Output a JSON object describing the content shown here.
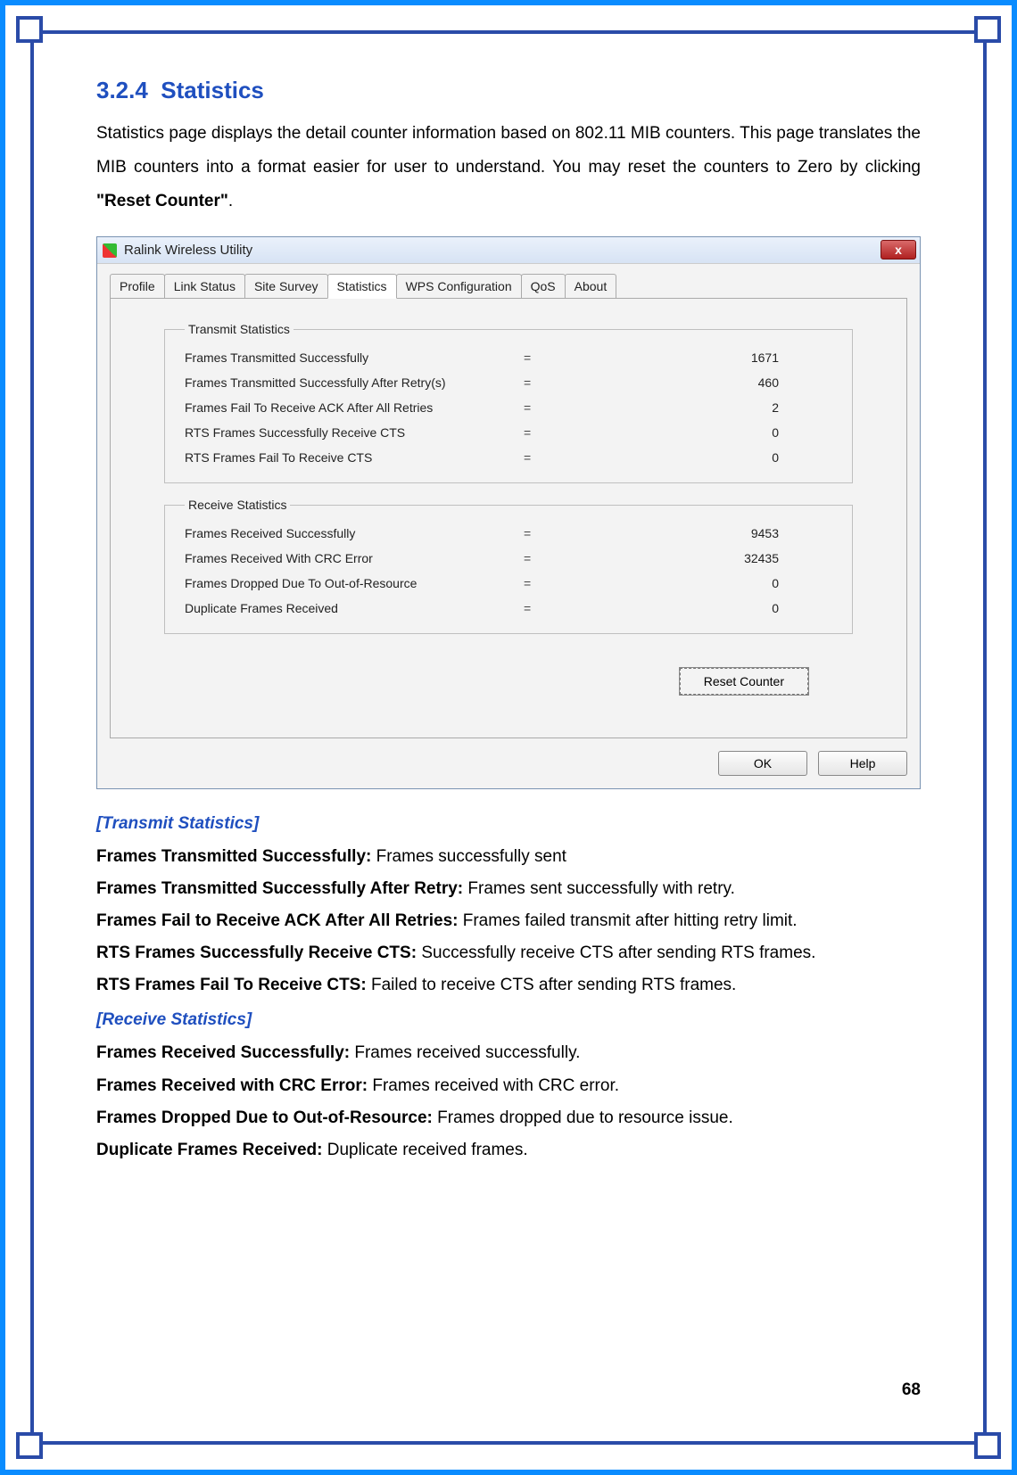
{
  "section": {
    "number": "3.2.4",
    "title": "Statistics",
    "intro_pre": "Statistics page displays the detail counter information based on 802.11 MIB counters. This page translates the MIB counters into a format easier for user to understand. You may reset the counters to Zero by clicking ",
    "intro_bold": "\"Reset Counter\"",
    "intro_post": "."
  },
  "dialog": {
    "title": "Ralink Wireless Utility",
    "close_x": "x",
    "tabs": [
      "Profile",
      "Link Status",
      "Site Survey",
      "Statistics",
      "WPS Configuration",
      "QoS",
      "About"
    ],
    "active_tab_index": 3,
    "transmit_legend": "Transmit Statistics",
    "receive_legend": "Receive Statistics",
    "transmit_rows": [
      {
        "label": "Frames Transmitted Successfully",
        "value": "1671"
      },
      {
        "label": "Frames Transmitted Successfully After Retry(s)",
        "value": "460"
      },
      {
        "label": "Frames Fail To Receive ACK After All Retries",
        "value": "2"
      },
      {
        "label": "RTS Frames Successfully Receive CTS",
        "value": "0"
      },
      {
        "label": "RTS Frames Fail To Receive CTS",
        "value": "0"
      }
    ],
    "receive_rows": [
      {
        "label": "Frames Received Successfully",
        "value": "9453"
      },
      {
        "label": "Frames Received With CRC Error",
        "value": "32435"
      },
      {
        "label": "Frames Dropped Due To Out-of-Resource",
        "value": "0"
      },
      {
        "label": "Duplicate Frames Received",
        "value": "0"
      }
    ],
    "reset_btn": "Reset Counter",
    "ok_btn": "OK",
    "help_btn": "Help"
  },
  "desc": {
    "transmit_heading": "[Transmit Statistics]",
    "receive_heading": "[Receive Statistics]",
    "transmit_items": [
      {
        "term": "Frames Transmitted Successfully: ",
        "def": "Frames successfully sent"
      },
      {
        "term": "Frames Transmitted Successfully After Retry: ",
        "def": "Frames sent successfully with retry."
      },
      {
        "term": "Frames Fail to Receive ACK After All Retries: ",
        "def": "Frames failed transmit after hitting retry limit."
      },
      {
        "term": "RTS Frames Successfully Receive CTS: ",
        "def": "Successfully receive CTS after sending RTS frames."
      },
      {
        "term": "RTS Frames Fail To Receive CTS: ",
        "def": "Failed to receive CTS after sending RTS frames."
      }
    ],
    "receive_items": [
      {
        "term": "Frames Received Successfully: ",
        "def": "Frames received successfully."
      },
      {
        "term": "Frames Received with CRC Error: ",
        "def": "Frames received with CRC error."
      },
      {
        "term": "Frames Dropped Due to Out-of-Resource: ",
        "def": "Frames dropped due to resource issue."
      },
      {
        "term": "Duplicate Frames Received: ",
        "def": "Duplicate received frames."
      }
    ]
  },
  "page_number": "68",
  "chart_data": {
    "type": "table",
    "title": "Statistics",
    "series": [
      {
        "name": "Transmit Statistics",
        "categories": [
          "Frames Transmitted Successfully",
          "Frames Transmitted Successfully After Retry(s)",
          "Frames Fail To Receive ACK After All Retries",
          "RTS Frames Successfully Receive CTS",
          "RTS Frames Fail To Receive CTS"
        ],
        "values": [
          1671,
          460,
          2,
          0,
          0
        ]
      },
      {
        "name": "Receive Statistics",
        "categories": [
          "Frames Received Successfully",
          "Frames Received With CRC Error",
          "Frames Dropped Due To Out-of-Resource",
          "Duplicate Frames Received"
        ],
        "values": [
          9453,
          32435,
          0,
          0
        ]
      }
    ]
  }
}
